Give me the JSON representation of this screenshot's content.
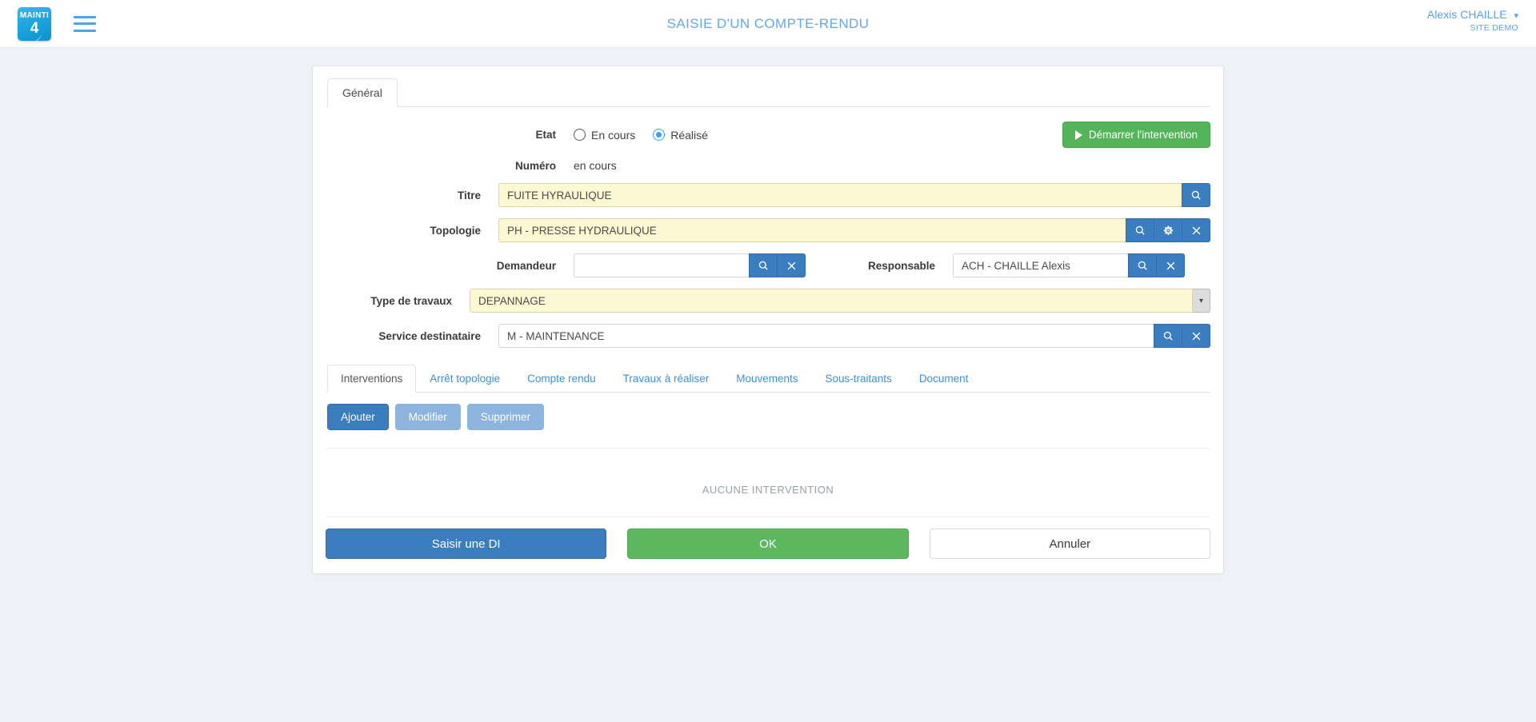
{
  "header": {
    "logo_line1": "MAINTI",
    "logo_line2": "4",
    "title": "SAISIE D'UN COMPTE-RENDU",
    "user_name": "Alexis CHAILLE",
    "user_site": "SITE DEMO",
    "chevron": "⌄",
    "menu_icon": "hamburger-icon"
  },
  "main_tabs": [
    {
      "label": "Général",
      "active": true
    }
  ],
  "form": {
    "etat": {
      "label": "Etat",
      "options": [
        {
          "label": "En cours",
          "selected": false
        },
        {
          "label": "Réalisé",
          "selected": true
        }
      ],
      "start_button": "Démarrer l'intervention"
    },
    "numero": {
      "label": "Numéro",
      "value": "en cours"
    },
    "titre": {
      "label": "Titre",
      "value": "FUITE HYRAULIQUE"
    },
    "topologie": {
      "label": "Topologie",
      "value": "PH - PRESSE HYDRAULIQUE"
    },
    "demandeur": {
      "label": "Demandeur",
      "value": "",
      "placeholder": ""
    },
    "responsable": {
      "label": "Responsable",
      "value": "ACH - CHAILLE Alexis"
    },
    "type_travaux": {
      "label": "Type de travaux",
      "value": "DEPANNAGE"
    },
    "service_destinataire": {
      "label": "Service destinataire",
      "value": "M - MAINTENANCE"
    }
  },
  "lower_tabs": [
    {
      "label": "Interventions",
      "active": true
    },
    {
      "label": "Arrêt topologie",
      "active": false
    },
    {
      "label": "Compte rendu",
      "active": false
    },
    {
      "label": "Travaux à réaliser",
      "active": false
    },
    {
      "label": "Mouvements",
      "active": false
    },
    {
      "label": "Sous-traitants",
      "active": false
    },
    {
      "label": "Document",
      "active": false
    }
  ],
  "actions": {
    "add": "Ajouter",
    "edit": "Modifier",
    "delete": "Supprimer"
  },
  "empty_state": "AUCUNE INTERVENTION",
  "footer": {
    "saisir_di": "Saisir une DI",
    "ok": "OK",
    "annuler": "Annuler"
  },
  "colors": {
    "accent_blue": "#3a7ebf",
    "link_blue": "#5aa2e8",
    "green": "#5cb85f",
    "yellow_field": "#fcf8d4",
    "muted_blue": "#8cb4dc",
    "page_bg": "#eef1f6"
  }
}
